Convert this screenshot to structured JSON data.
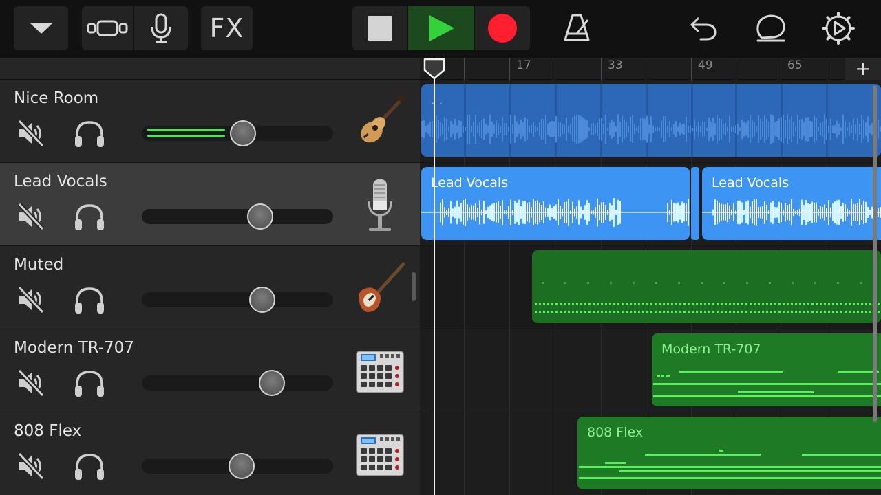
{
  "toolbar": {
    "fx_label": "FX",
    "icons": [
      "chevron-down-icon",
      "tracks-view-icon",
      "microphone-icon",
      "fx-icon",
      "stop-icon",
      "play-icon",
      "record-icon",
      "metronome-icon",
      "undo-icon",
      "loop-icon",
      "settings-icon"
    ],
    "play_active_color": "#33d23a",
    "record_color": "#ff1f2e"
  },
  "ruler": {
    "bar_labels": [
      "17",
      "33",
      "49",
      "65"
    ],
    "add_label": "+"
  },
  "tracks": [
    {
      "name": "Nice Room",
      "instrument": "acoustic-guitar-icon",
      "volume": 0.53,
      "meter_level": 0.42,
      "selected": false
    },
    {
      "name": "Lead Vocals",
      "instrument": "studio-microphone-icon",
      "volume": 0.62,
      "meter_level": 0,
      "selected": true
    },
    {
      "name": "Muted",
      "instrument": "bass-guitar-icon",
      "volume": 0.63,
      "meter_level": 0,
      "selected": false
    },
    {
      "name": "Modern TR-707",
      "instrument": "drum-machine-icon",
      "volume": 0.68,
      "meter_level": 0,
      "selected": false
    },
    {
      "name": "808 Flex",
      "instrument": "drum-machine-icon",
      "volume": 0.52,
      "meter_level": 0,
      "selected": false
    }
  ],
  "regions": {
    "nice_room": {
      "name": "",
      "color": "#2d68b8"
    },
    "lead_vocals_1": {
      "name": "Lead Vocals",
      "color": "#3e94f2"
    },
    "lead_vocals_2": {
      "name": "Lead Vocals",
      "color": "#3e94f2"
    },
    "muted": {
      "name": "",
      "color": "#1b6e22"
    },
    "modern_tr707": {
      "name": "Modern TR-707",
      "color": "#1f7a26"
    },
    "flex_808": {
      "name": "808 Flex",
      "color": "#1f7a26"
    }
  },
  "colors": {
    "meter_green": "#54e05c",
    "midi_green": "#5cf05f",
    "region_text_green": "#8ef090"
  }
}
